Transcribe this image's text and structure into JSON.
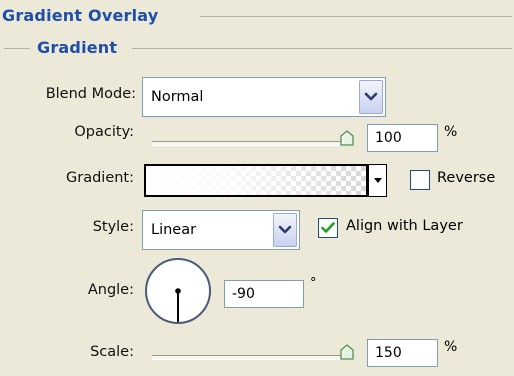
{
  "panel": {
    "title": "Gradient Overlay",
    "section_title": "Gradient"
  },
  "blend_mode": {
    "label": "Blend Mode:",
    "value": "Normal"
  },
  "opacity": {
    "label": "Opacity:",
    "value": "100",
    "unit": "%",
    "level": 1.0
  },
  "gradient": {
    "label": "Gradient:"
  },
  "reverse": {
    "label": "Reverse",
    "checked": false
  },
  "style": {
    "label": "Style:",
    "value": "Linear"
  },
  "align": {
    "label": "Align with Layer",
    "checked": true
  },
  "angle": {
    "label": "Angle:",
    "value": "-90",
    "unit": "°"
  },
  "scale": {
    "label": "Scale:",
    "value": "150",
    "unit": "%",
    "level": 1.0
  },
  "colors": {
    "header_text": "#1f4ea8",
    "check_green": "#21a121",
    "field_border": "#7f9db9"
  },
  "icons": {
    "dropdown": "chevron-down-icon",
    "slider": "slider-thumb-icon",
    "check": "checkmark-icon"
  }
}
